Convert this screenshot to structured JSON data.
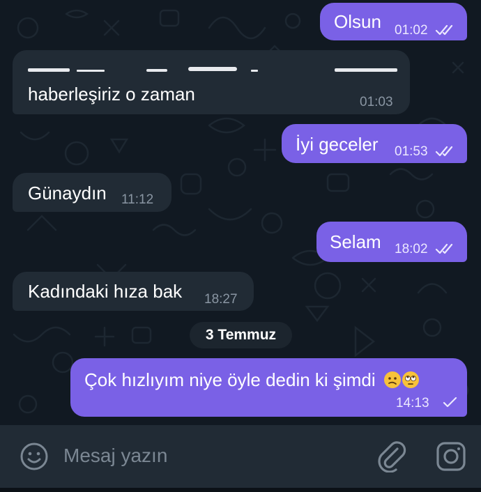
{
  "messages": [
    {
      "dir": "out",
      "text": "Olsun",
      "time": "01:02",
      "status": "read"
    },
    {
      "dir": "in",
      "text_line1_obscured": "Şimdi ... yarın ... yarın",
      "text": "haberleşiriz o zaman",
      "time": "01:03"
    },
    {
      "dir": "out",
      "text": "İyi geceler",
      "time": "01:53",
      "status": "read"
    },
    {
      "dir": "in",
      "text": "Günaydın",
      "time": "11:12"
    },
    {
      "dir": "out",
      "text": "Selam",
      "time": "18:02",
      "status": "read"
    },
    {
      "dir": "in",
      "text": "Kadındaki hıza bak",
      "time": "18:27"
    },
    {
      "dir": "out",
      "text": "Çok hızlıyım niye öyle dedin ki şimdi",
      "emoji": [
        "confused-face",
        "face-with-rolling-eyes"
      ],
      "time": "14:13",
      "status": "sent"
    }
  ],
  "date_separator": "3 Temmuz",
  "composer": {
    "placeholder": "Mesaj yazın"
  },
  "icons": {
    "emoji": "smiley-icon",
    "attach": "paperclip-icon",
    "camera": "instagram-camera-icon"
  },
  "colors": {
    "outgoing": "#7a61e6",
    "incoming": "#212b35",
    "background": "#111922"
  }
}
